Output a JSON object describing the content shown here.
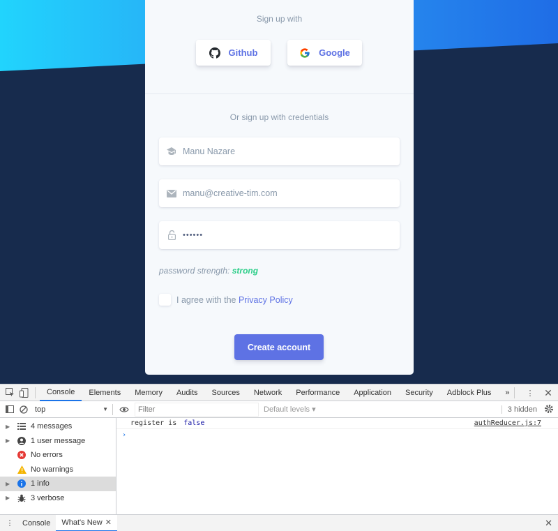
{
  "auth": {
    "signup_with": "Sign up with",
    "github_label": "Github",
    "google_label": "Google",
    "credentials_label": "Or sign up with credentials",
    "name_value": "Manu Nazare",
    "email_value": "manu@creative-tim.com",
    "password_value": "••••••",
    "strength_label": "password strength:",
    "strength_value": "strong",
    "agree_text": "I agree with the",
    "privacy_link": "Privacy Policy",
    "create_button": "Create account"
  },
  "devtools": {
    "tabs": [
      "Console",
      "Elements",
      "Memory",
      "Audits",
      "Sources",
      "Network",
      "Performance",
      "Application",
      "Security",
      "Adblock Plus"
    ],
    "more": "»",
    "context": "top",
    "filter_placeholder": "Filter",
    "levels": "Default levels ▾",
    "hidden": "3 hidden",
    "sidebar": [
      {
        "label": "4 messages",
        "icon": "list-icon"
      },
      {
        "label": "1 user message",
        "icon": "user-icon"
      },
      {
        "label": "No errors",
        "icon": "error-icon"
      },
      {
        "label": "No warnings",
        "icon": "warning-icon"
      },
      {
        "label": "1 info",
        "icon": "info-icon"
      },
      {
        "label": "3 verbose",
        "icon": "bug-icon"
      }
    ],
    "log": {
      "text": "register is",
      "value": "false",
      "source": "authReducer.js:7"
    },
    "drawer_tabs": [
      "Console",
      "What's New"
    ]
  },
  "colors": {
    "accent": "#5e72e4",
    "success": "#2dce89",
    "dark_bg": "#172b4d"
  }
}
